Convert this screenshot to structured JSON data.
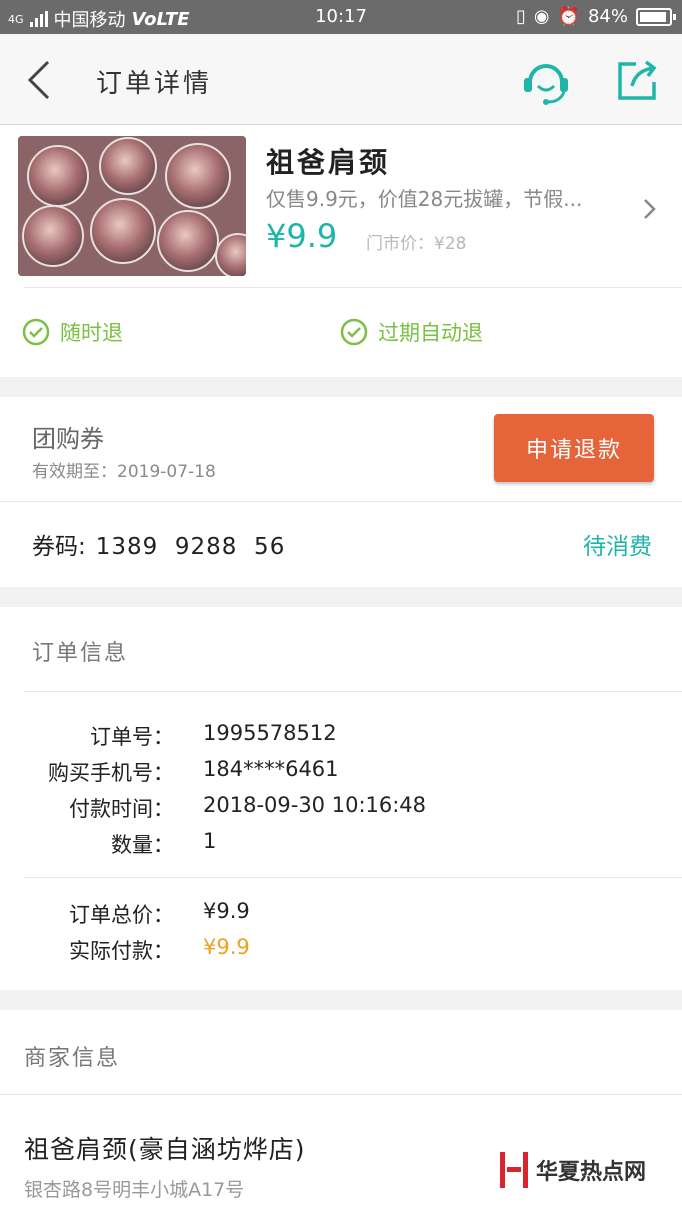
{
  "status_bar": {
    "network": "4G",
    "carrier": "中国移动",
    "volte": "VoLTE",
    "time": "10:17",
    "battery": "84%"
  },
  "header": {
    "title": "订单详情",
    "icons": [
      "back-icon",
      "customer-service-icon",
      "share-icon"
    ]
  },
  "product": {
    "name": "祖爸肩颈",
    "desc": "仅售9.9元，价值28元拔罐，节假...",
    "price": "¥9.9",
    "market_price": "门市价：¥28"
  },
  "guarantees": [
    "随时退",
    "过期自动退"
  ],
  "voucher": {
    "title": "团购券",
    "valid_until": "有效期至：2019-07-18",
    "refund_label": "申请退款",
    "code_label": "券码:",
    "code": "1389  9288  56",
    "status": "待消费"
  },
  "order": {
    "title": "订单信息",
    "rows": [
      {
        "k": "订单号：",
        "v": "1995578512"
      },
      {
        "k": "购买手机号：",
        "v": "184****6461"
      },
      {
        "k": "付款时间：",
        "v": "2018-09-30 10:16:48"
      },
      {
        "k": "数量：",
        "v": "1"
      }
    ],
    "totals": [
      {
        "k": "订单总价：",
        "v": "¥9.9"
      },
      {
        "k": "实际付款：",
        "v": "¥9.9"
      }
    ]
  },
  "merchant": {
    "title": "商家信息",
    "name": "祖爸肩颈(豪自涵坊烨店)",
    "address": "银杏路8号明丰小城A17号"
  },
  "watermark": "华夏热点网",
  "colors": {
    "accent": "#1fb5a8",
    "refund": "#e6643a",
    "guarantee": "#7ac142",
    "paid": "#f0a020"
  }
}
